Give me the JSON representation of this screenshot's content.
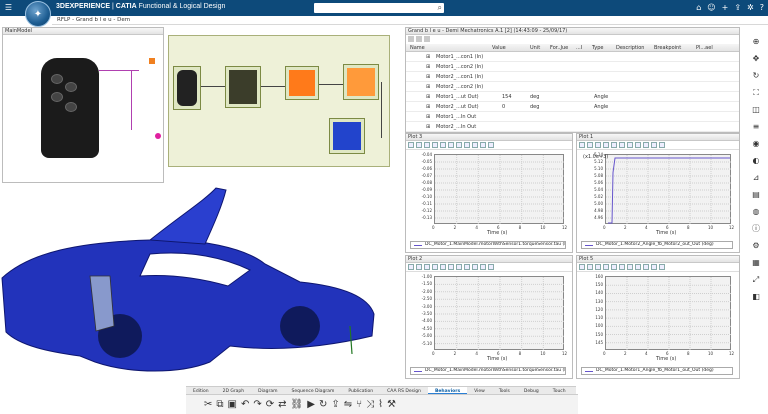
{
  "topbar": {
    "brand": "3DEXPERIENCE",
    "app": "CATIA",
    "title": "Functional & Logical Design",
    "search_placeholder": "",
    "left_icons": [
      "menu-icon",
      "home-icon",
      "back-icon"
    ],
    "right_icons": [
      "user-icon",
      "add-icon",
      "share-icon",
      "community-icon",
      "help-icon"
    ]
  },
  "subbar": {
    "breadcrumb": "RFLP - Grand b l e u - Dem"
  },
  "main_model_panel": {
    "title": "MainModel"
  },
  "table_panel": {
    "title": "Grand b l e u - Demi Mechatronics A.1 [2] (14:43:09 - 25/09/17)",
    "columns": [
      "Name",
      "Value",
      "Unit",
      "For..Jue",
      "...I",
      "Type",
      "Description",
      "Breakpoint",
      "Pl...ael"
    ],
    "rows": [
      {
        "name": "Motor1_...con1 (In)",
        "value": "",
        "unit": "",
        "type": ""
      },
      {
        "name": "Motor1_...con2 (In)",
        "value": "",
        "unit": "",
        "type": ""
      },
      {
        "name": "Motor2_...con1 (In)",
        "value": "",
        "unit": "",
        "type": ""
      },
      {
        "name": "Motor2_...con2 (In)",
        "value": "",
        "unit": "",
        "type": ""
      },
      {
        "name": "Motor1_...ut Out)",
        "value": "154",
        "unit": "deg",
        "type": "Angle"
      },
      {
        "name": "Motor2_...ut Out)",
        "value": "0",
        "unit": "deg",
        "type": "Angle"
      },
      {
        "name": "Motor1_...In Out",
        "value": "",
        "unit": "",
        "type": ""
      },
      {
        "name": "Motor2_...In Out",
        "value": "",
        "unit": "",
        "type": ""
      }
    ]
  },
  "plots": [
    {
      "title": "Plot 3",
      "xlabel": "Time (s)",
      "yticks": [
        "-0.04",
        "-0.05",
        "-0.06",
        "-0.07",
        "-0.08",
        "-0.09",
        "-0.10",
        "-0.11",
        "-0.12",
        "-0.13"
      ],
      "xticks": [
        "0",
        "2",
        "4",
        "6",
        "8",
        "10",
        "12"
      ],
      "legend": "DC_Motor_1.MainModel.motorWithSensor1.torqueSensor.tau (Nxm)"
    },
    {
      "title": "Plot 1",
      "xlabel": "Time (s)",
      "yticks": [
        "5.14",
        "5.12",
        "5.10",
        "5.08",
        "5.06",
        "5.04",
        "5.02",
        "5.00",
        "4.98",
        "4.96"
      ],
      "ylabel_top": "(x1.0e+3)",
      "xticks": [
        "0",
        "2",
        "4",
        "6",
        "8",
        "10",
        "12"
      ],
      "legend": "DC_Motor_1.Motor2_Angle_fb_Motor2_out_Out (deg)"
    },
    {
      "title": "Plot 2",
      "xlabel": "Time (s)",
      "yticks": [
        "-1.00",
        "-1.50",
        "-2.00",
        "-2.50",
        "-3.00",
        "-3.50",
        "-4.00",
        "-4.50",
        "-5.00",
        "-5.10"
      ],
      "xticks": [
        "0",
        "2",
        "4",
        "6",
        "8",
        "10",
        "12"
      ],
      "legend": "DC_Motor_1.MainModel.motorWithSensor1.torqueSensor.tau (Nxm)"
    },
    {
      "title": "Plot 5",
      "xlabel": "Time (s)",
      "yticks": [
        "160",
        "150",
        "140",
        "130",
        "120",
        "110",
        "100",
        "150",
        "145"
      ],
      "xticks": [
        "0",
        "2",
        "4",
        "6",
        "8",
        "10",
        "12"
      ],
      "legend": "DC_Motor_1.Motor1_Angle_fb_Motor1_out_Out (deg)"
    }
  ],
  "bottom_tabs": [
    "Edition",
    "2D Graph",
    "Diagram",
    "Sequence Diagram",
    "Publication",
    "CAA RS Design",
    "Behaviors",
    "View",
    "Tools",
    "Debug",
    "Touch"
  ],
  "active_tab": "Behaviors",
  "colors": {
    "topbar": "#0d4a7a",
    "car": "#2233bb",
    "curve": "#6655cc",
    "active_tab": "#0b5fa5"
  }
}
